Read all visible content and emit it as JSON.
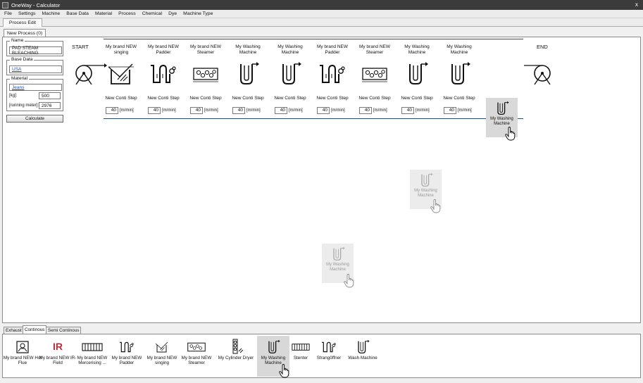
{
  "window": {
    "title": "OneWay - Calculator",
    "close_label": "x"
  },
  "menu": [
    "File",
    "Settings",
    "Machine",
    "Base Data",
    "Material",
    "Process",
    "Chemical",
    "Dye",
    "Machine Type"
  ],
  "ribbon": {
    "tab": "Process Edit"
  },
  "document_tab": "New Process (0)",
  "left_panel": {
    "name_group": "Name",
    "name_value": "PAD STEAM BLEACHING",
    "base_data_group": "Base Data",
    "base_data_value": "USA",
    "material_group": "Material",
    "material_value": "Jeans",
    "kg_label": "[kg]:",
    "kg_value": "500",
    "running_meter_label": "[running meter]:",
    "running_meter_value": "2976",
    "calculate_label": "Calculate"
  },
  "process": {
    "start_label": "START",
    "end_label": "END",
    "steps": [
      {
        "title": "My brand NEW singing",
        "icon": "singing-icon",
        "sub": "New Conti Step",
        "speed": "40",
        "unit": "[m/min]"
      },
      {
        "title": "My brand NEW Padder",
        "icon": "padder-icon",
        "sub": "New Conti Step",
        "speed": "40",
        "unit": "[m/min]"
      },
      {
        "title": "My brand NEW Steamer",
        "icon": "steamer-icon",
        "sub": "New Conti Step",
        "speed": "40",
        "unit": "[m/min]"
      },
      {
        "title": "My Washing Machine",
        "icon": "washing-machine-icon",
        "sub": "New Conti Step",
        "speed": "40",
        "unit": "[m/min]"
      },
      {
        "title": "My Washing Machine",
        "icon": "washing-machine-icon",
        "sub": "New Conti Step",
        "speed": "40",
        "unit": "[m/min]"
      },
      {
        "title": "My brand NEW Padder",
        "icon": "padder-icon",
        "sub": "New Conti Step",
        "speed": "40",
        "unit": "[m/min]"
      },
      {
        "title": "My brand NEW Steamer",
        "icon": "steamer-icon",
        "sub": "New Conti Step",
        "speed": "40",
        "unit": "[m/min]"
      },
      {
        "title": "My Washing Machine",
        "icon": "washing-machine-icon",
        "sub": "New Conti Step",
        "speed": "40",
        "unit": "[m/min]"
      },
      {
        "title": "My Washing Machine",
        "icon": "washing-machine-icon",
        "sub": "New Conti Step",
        "speed": "40",
        "unit": "[m/min]"
      }
    ],
    "drag_items": [
      {
        "label": "My Washing Machine"
      },
      {
        "label": "My Washing Machine"
      },
      {
        "label": "My Washing Machine"
      }
    ]
  },
  "bottom_tabs": [
    "Exhaust",
    "Continous",
    "Semi Continous"
  ],
  "toolbox": [
    {
      "label": "My brand NEW Hot Flue",
      "icon": "hot-flue-icon"
    },
    {
      "label": "My brand NEW IR-Field",
      "icon": "ir-field-icon",
      "icon_text": "IR"
    },
    {
      "label": "My brand NEW Mercerising ...",
      "icon": "mercerising-icon"
    },
    {
      "label": "My brand NEW Padder",
      "icon": "padder-icon"
    },
    {
      "label": "My brand NEW singing",
      "icon": "singing-icon"
    },
    {
      "label": "My brand NEW Steamer",
      "icon": "steamer-icon"
    },
    {
      "label": "My Cylinder Dryer",
      "icon": "cylinder-dryer-icon"
    },
    {
      "label": "My Washing Machine",
      "icon": "washing-machine-icon"
    },
    {
      "label": "Stenter",
      "icon": "stenter-icon"
    },
    {
      "label": "Strangöffner",
      "icon": "strangoeffner-icon"
    },
    {
      "label": "Wash Machine",
      "icon": "wash-machine-icon"
    }
  ]
}
